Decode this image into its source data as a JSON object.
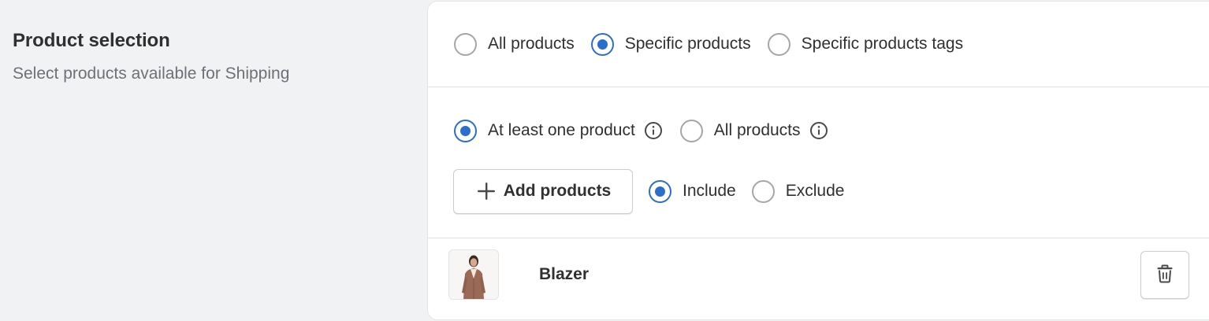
{
  "section": {
    "title": "Product selection",
    "description": "Select products available for Shipping"
  },
  "scope_options": [
    {
      "label": "All products",
      "checked": false
    },
    {
      "label": "Specific products",
      "checked": true
    },
    {
      "label": "Specific products tags",
      "checked": false
    }
  ],
  "match_options": [
    {
      "label": "At least one product",
      "checked": true,
      "info": true
    },
    {
      "label": "All products",
      "checked": false,
      "info": true
    }
  ],
  "add_button": {
    "label": "Add products",
    "icon": "plus-icon"
  },
  "mode_options": [
    {
      "label": "Include",
      "checked": true
    },
    {
      "label": "Exclude",
      "checked": false
    }
  ],
  "products": [
    {
      "name": "Blazer",
      "thumbnail": "blazer-thumbnail",
      "action_icon": "trash-icon"
    }
  ],
  "colors": {
    "accent": "#2c6ecb",
    "background": "#f1f2f4"
  }
}
